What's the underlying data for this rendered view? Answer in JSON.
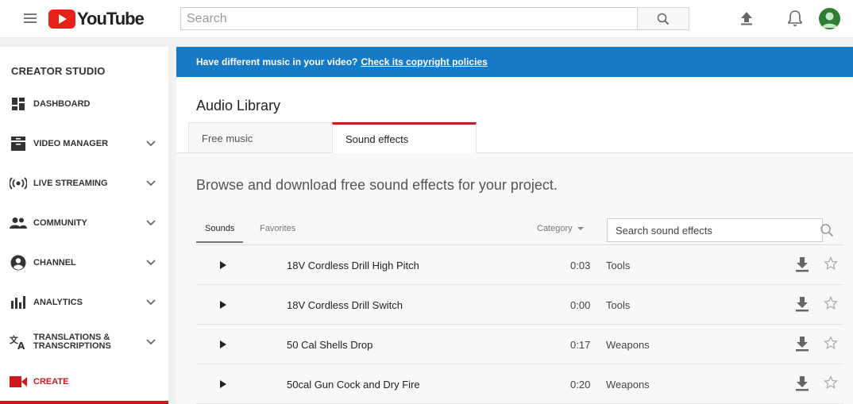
{
  "header": {
    "logo_text": "YouTube",
    "search_placeholder": "Search"
  },
  "sidebar": {
    "title": "CREATOR STUDIO",
    "items": [
      {
        "label": "DASHBOARD",
        "icon": "dashboard-icon",
        "has_chevron": false
      },
      {
        "label": "VIDEO MANAGER",
        "icon": "video-manager-icon",
        "has_chevron": true
      },
      {
        "label": "LIVE STREAMING",
        "icon": "live-streaming-icon",
        "has_chevron": true
      },
      {
        "label": "COMMUNITY",
        "icon": "community-icon",
        "has_chevron": true
      },
      {
        "label": "CHANNEL",
        "icon": "channel-icon",
        "has_chevron": true
      },
      {
        "label": "ANALYTICS",
        "icon": "analytics-icon",
        "has_chevron": true
      },
      {
        "label_line1": "TRANSLATIONS &",
        "label_line2": "TRANSCRIPTIONS",
        "icon": "translate-icon",
        "has_chevron": true
      },
      {
        "label": "CREATE",
        "icon": "create-icon",
        "has_chevron": false,
        "active": true
      }
    ]
  },
  "banner": {
    "text": "Have different music in your video?",
    "link": "Check its copyright policies"
  },
  "main": {
    "title": "Audio Library",
    "tabs": [
      {
        "label": "Free music",
        "active": false
      },
      {
        "label": "Sound effects",
        "active": true
      }
    ],
    "lead": "Browse and download free sound effects for your project.",
    "subtabs": [
      {
        "label": "Sounds",
        "active": true
      },
      {
        "label": "Favorites",
        "active": false
      }
    ],
    "category_label": "Category",
    "search_placeholder": "Search sound effects",
    "rows": [
      {
        "name": "18V Cordless Drill High Pitch",
        "duration": "0:03",
        "category": "Tools"
      },
      {
        "name": "18V Cordless Drill Switch",
        "duration": "0:00",
        "category": "Tools"
      },
      {
        "name": "50 Cal Shells Drop",
        "duration": "0:17",
        "category": "Weapons"
      },
      {
        "name": "50cal Gun Cock and Dry Fire",
        "duration": "0:20",
        "category": "Weapons"
      }
    ]
  },
  "colors": {
    "brand_red": "#cc181e",
    "banner_blue": "#167ac6"
  }
}
